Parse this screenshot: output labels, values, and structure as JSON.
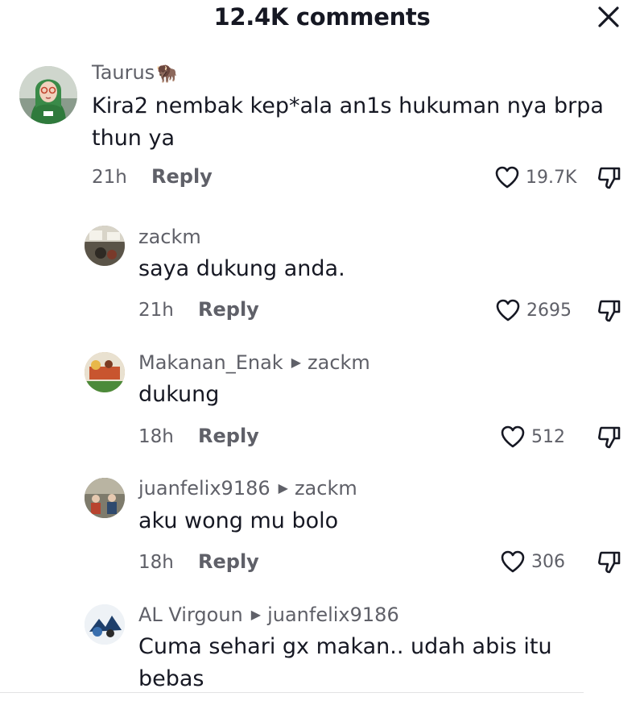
{
  "header": {
    "title": "12.4K comments",
    "close_icon": "close-icon"
  },
  "comments": [
    {
      "username": "Taurus",
      "badge": "🦬",
      "text": "Kira2 nembak kep*ala an1s hukuman nya brpa thun ya",
      "time": "21h",
      "reply_label": "Reply",
      "likes": "19.7K"
    },
    {
      "username": "zackm",
      "text": "saya dukung anda.",
      "time": "21h",
      "reply_label": "Reply",
      "likes": "2695"
    },
    {
      "username": "Makanan_Enak",
      "reply_to": "zackm",
      "text": "dukung",
      "time": "18h",
      "reply_label": "Reply",
      "likes": "512"
    },
    {
      "username": "juanfelix9186",
      "reply_to": "zackm",
      "text": "aku wong mu bolo",
      "time": "18h",
      "reply_label": "Reply",
      "likes": "306"
    },
    {
      "username": "AL Virgoun",
      "reply_to": "juanfelix9186",
      "text": "Cuma sehari gx makan.. udah abis itu bebas"
    }
  ]
}
